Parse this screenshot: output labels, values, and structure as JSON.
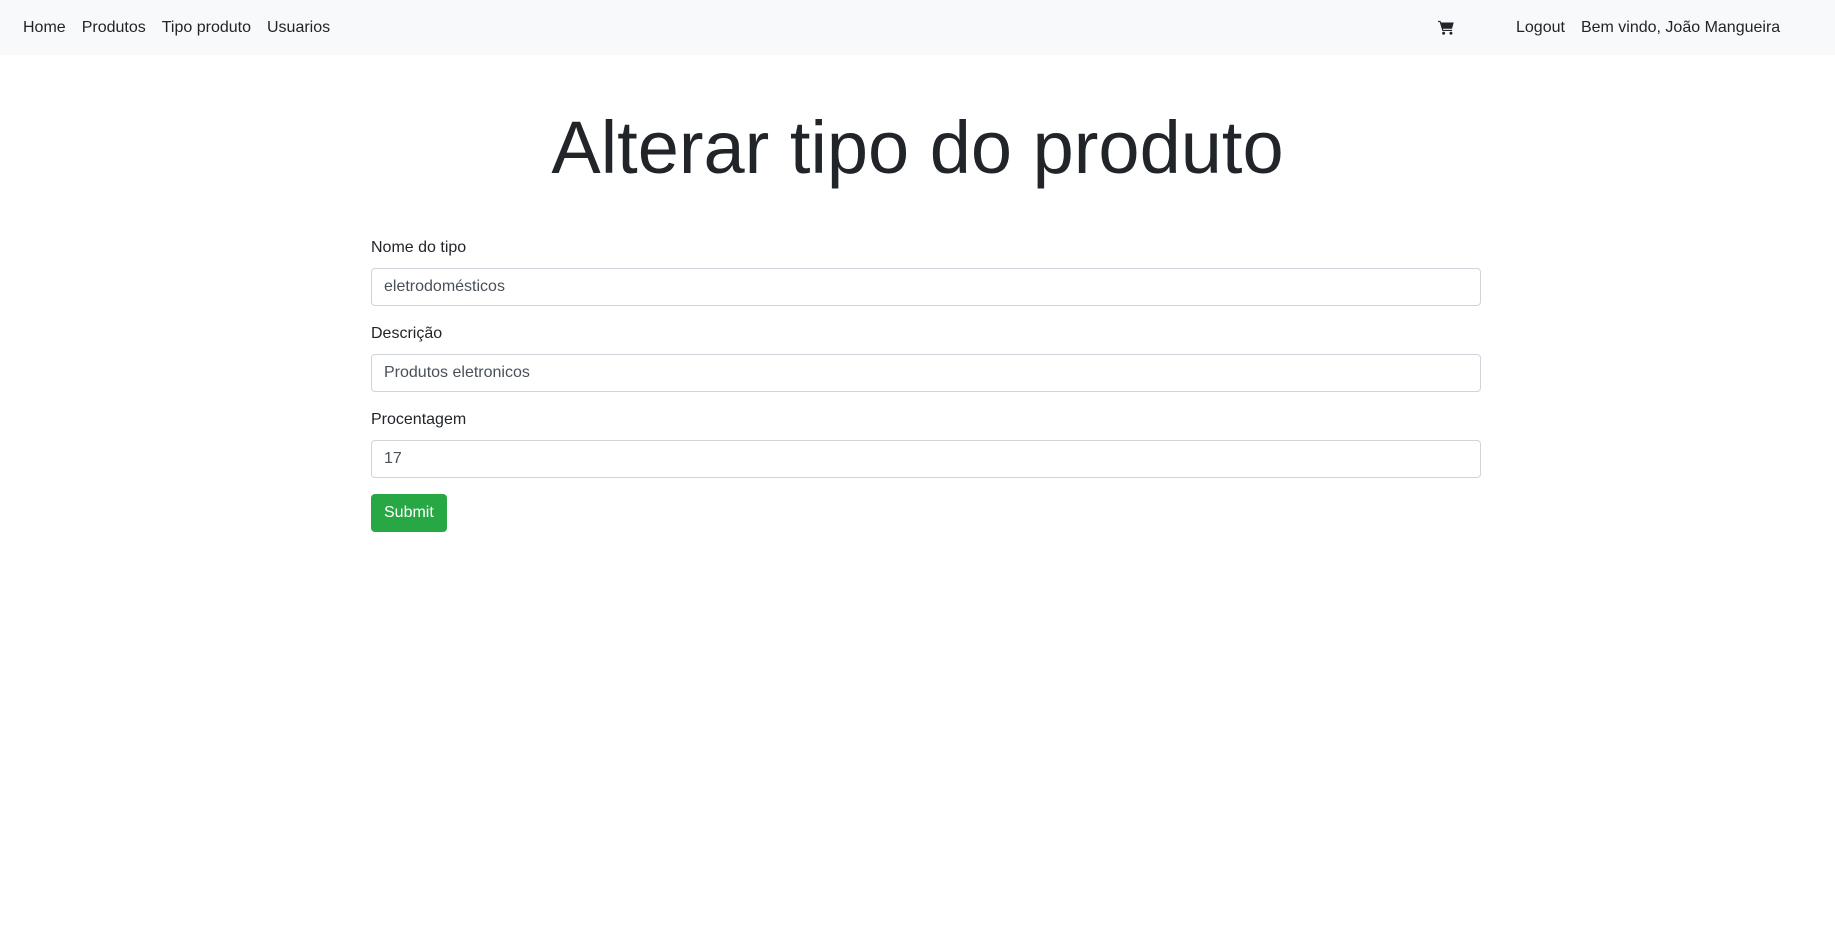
{
  "nav": {
    "links": [
      "Home",
      "Produtos",
      "Tipo produto",
      "Usuarios"
    ],
    "cart_icon": "cart-icon",
    "logout": "Logout",
    "welcome": "Bem vindo, João Mangueira"
  },
  "page": {
    "title": "Alterar tipo do produto"
  },
  "form": {
    "nome": {
      "label": "Nome do tipo",
      "value": "eletrodomésticos"
    },
    "descricao": {
      "label": "Descrição",
      "value": "Produtos eletronicos"
    },
    "porcentagem": {
      "label": "Procentagem",
      "value": "17"
    },
    "submit_label": "Submit",
    "submit_color": "#28a745"
  }
}
